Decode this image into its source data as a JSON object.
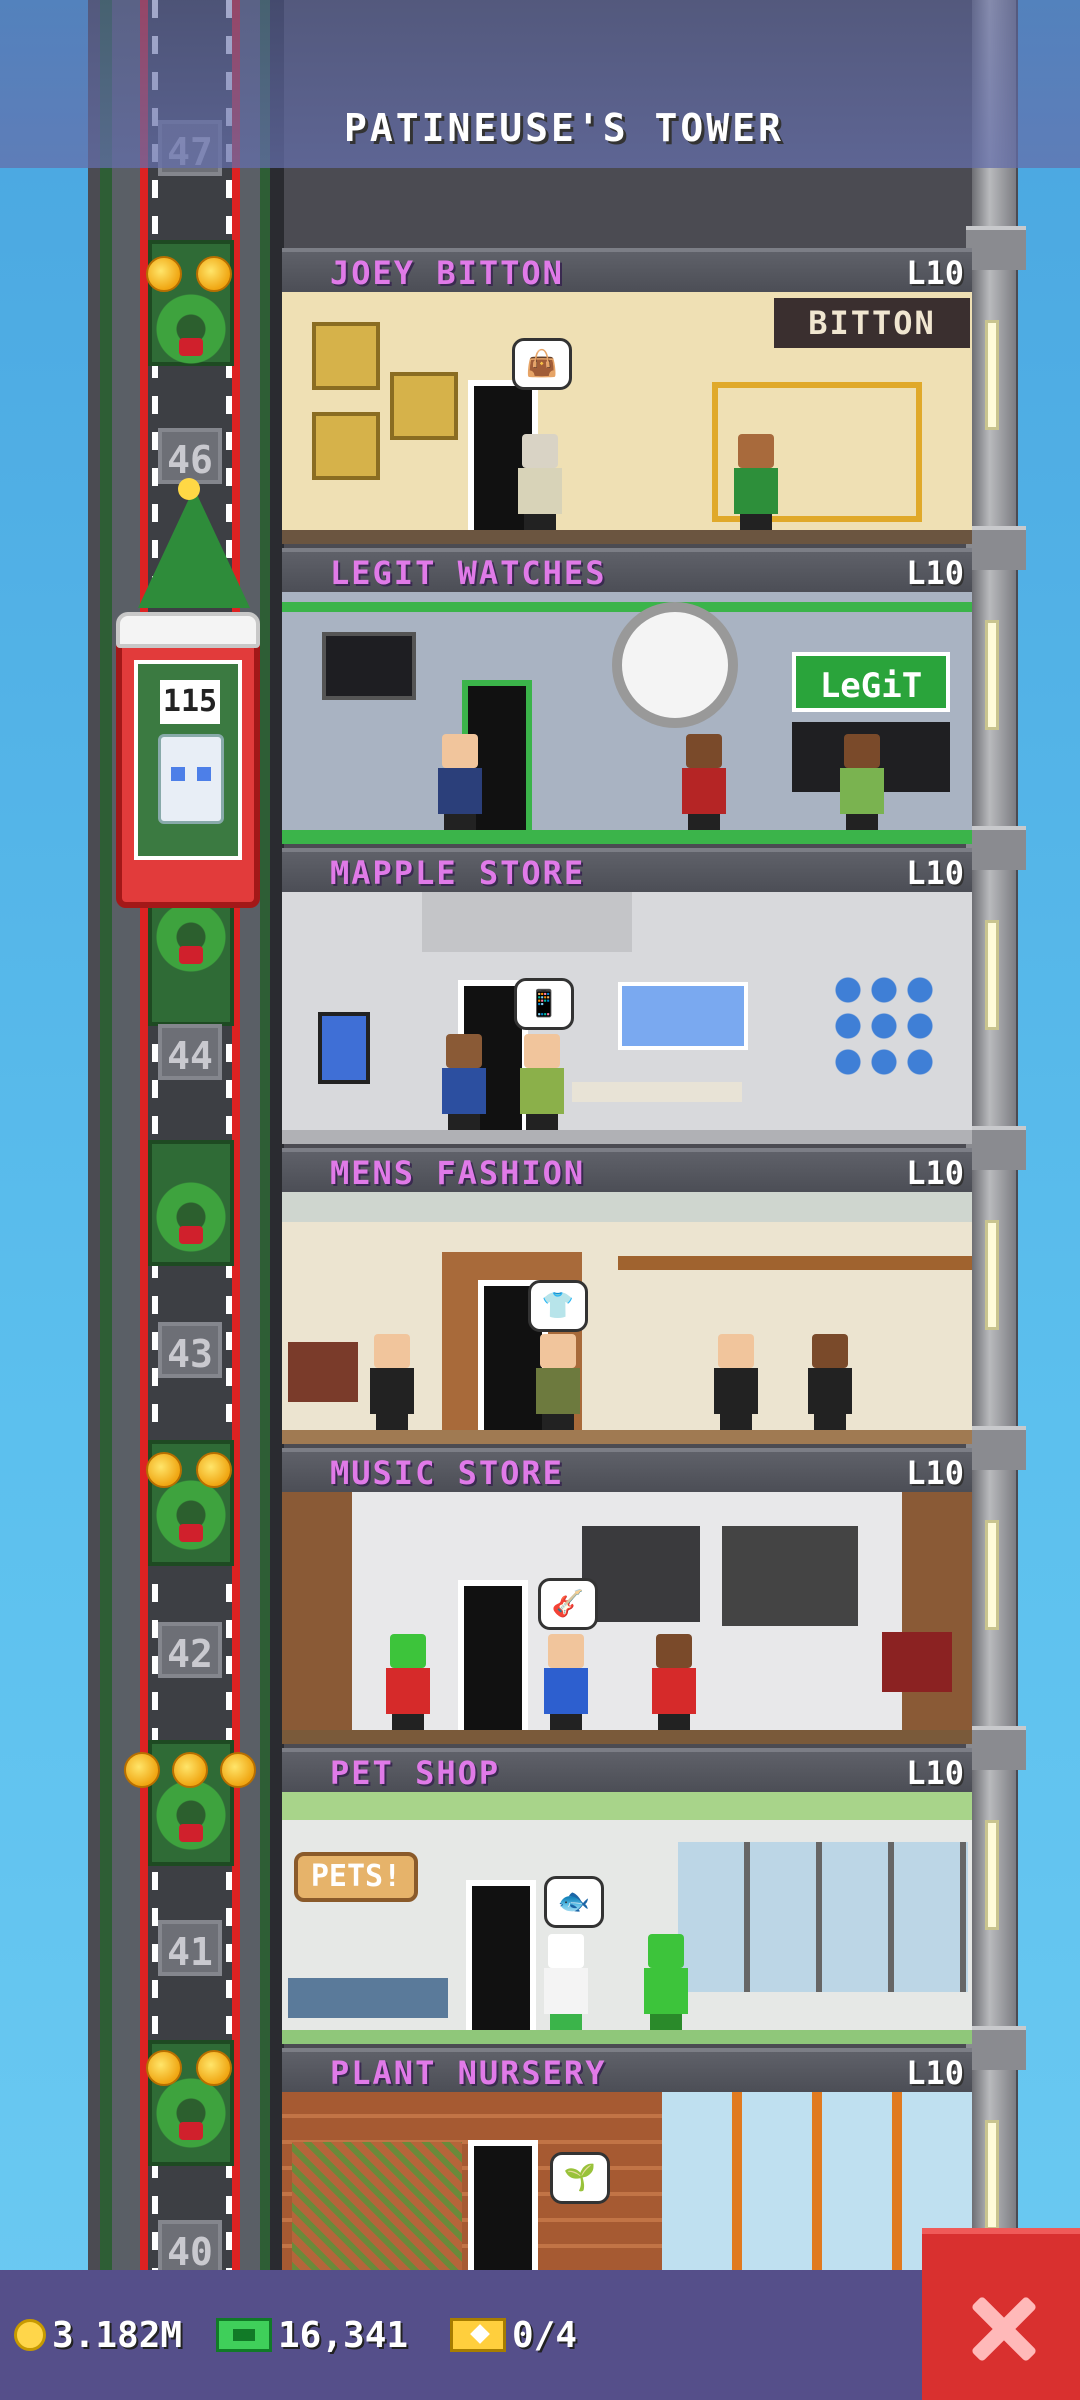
{
  "tower": {
    "title": "PATINEUSE'S TOWER"
  },
  "elevator": {
    "count": "115"
  },
  "shaft_floor_numbers": [
    "47",
    "46",
    "44",
    "43",
    "42",
    "41",
    "40"
  ],
  "floors": [
    {
      "name": "JOEY BITTON",
      "level": "L10",
      "sign": "BITTON"
    },
    {
      "name": "LEGIT WATCHES",
      "level": "L10",
      "sign": "LeGiT"
    },
    {
      "name": "MAPPLE STORE",
      "level": "L10"
    },
    {
      "name": "MENS FASHION",
      "level": "L10"
    },
    {
      "name": "MUSIC STORE",
      "level": "L10"
    },
    {
      "name": "PET SHOP",
      "level": "L10",
      "sign": "PETS!"
    },
    {
      "name": "PLANT NURSERY",
      "level": "L10"
    }
  ],
  "hud": {
    "coins": "3.182M",
    "bux": "16,341",
    "tickets": "0/4"
  },
  "colors": {
    "floor_name": "#e07ae8",
    "hud_bg": "#554f8a",
    "close_button": "#d9302f",
    "shaft_rail": "#dd2222"
  }
}
